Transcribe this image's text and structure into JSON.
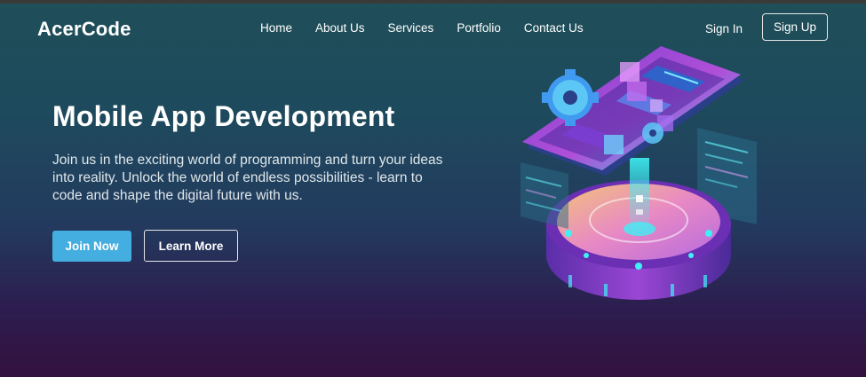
{
  "brand": {
    "name": "AcerCode"
  },
  "nav": {
    "items": [
      {
        "label": "Home"
      },
      {
        "label": "About Us"
      },
      {
        "label": "Services"
      },
      {
        "label": "Portfolio"
      },
      {
        "label": "Contact Us"
      }
    ]
  },
  "auth": {
    "signin_label": "Sign In",
    "signup_label": "Sign Up"
  },
  "hero": {
    "title": "Mobile App Development",
    "description": "Join us in the exciting world of programming and turn your ideas into reality. Unlock the world of endless possibilities - learn to code and shape the digital future with us.",
    "primary_cta": "Join Now",
    "secondary_cta": "Learn More",
    "illustration_icon": "isometric-phone-illustration"
  },
  "colors": {
    "accent": "#45aee0",
    "bg_top": "#1f4f59",
    "bg_bottom": "#34113f",
    "neon_cyan": "#29e3ee",
    "neon_purple": "#a64fd6"
  }
}
